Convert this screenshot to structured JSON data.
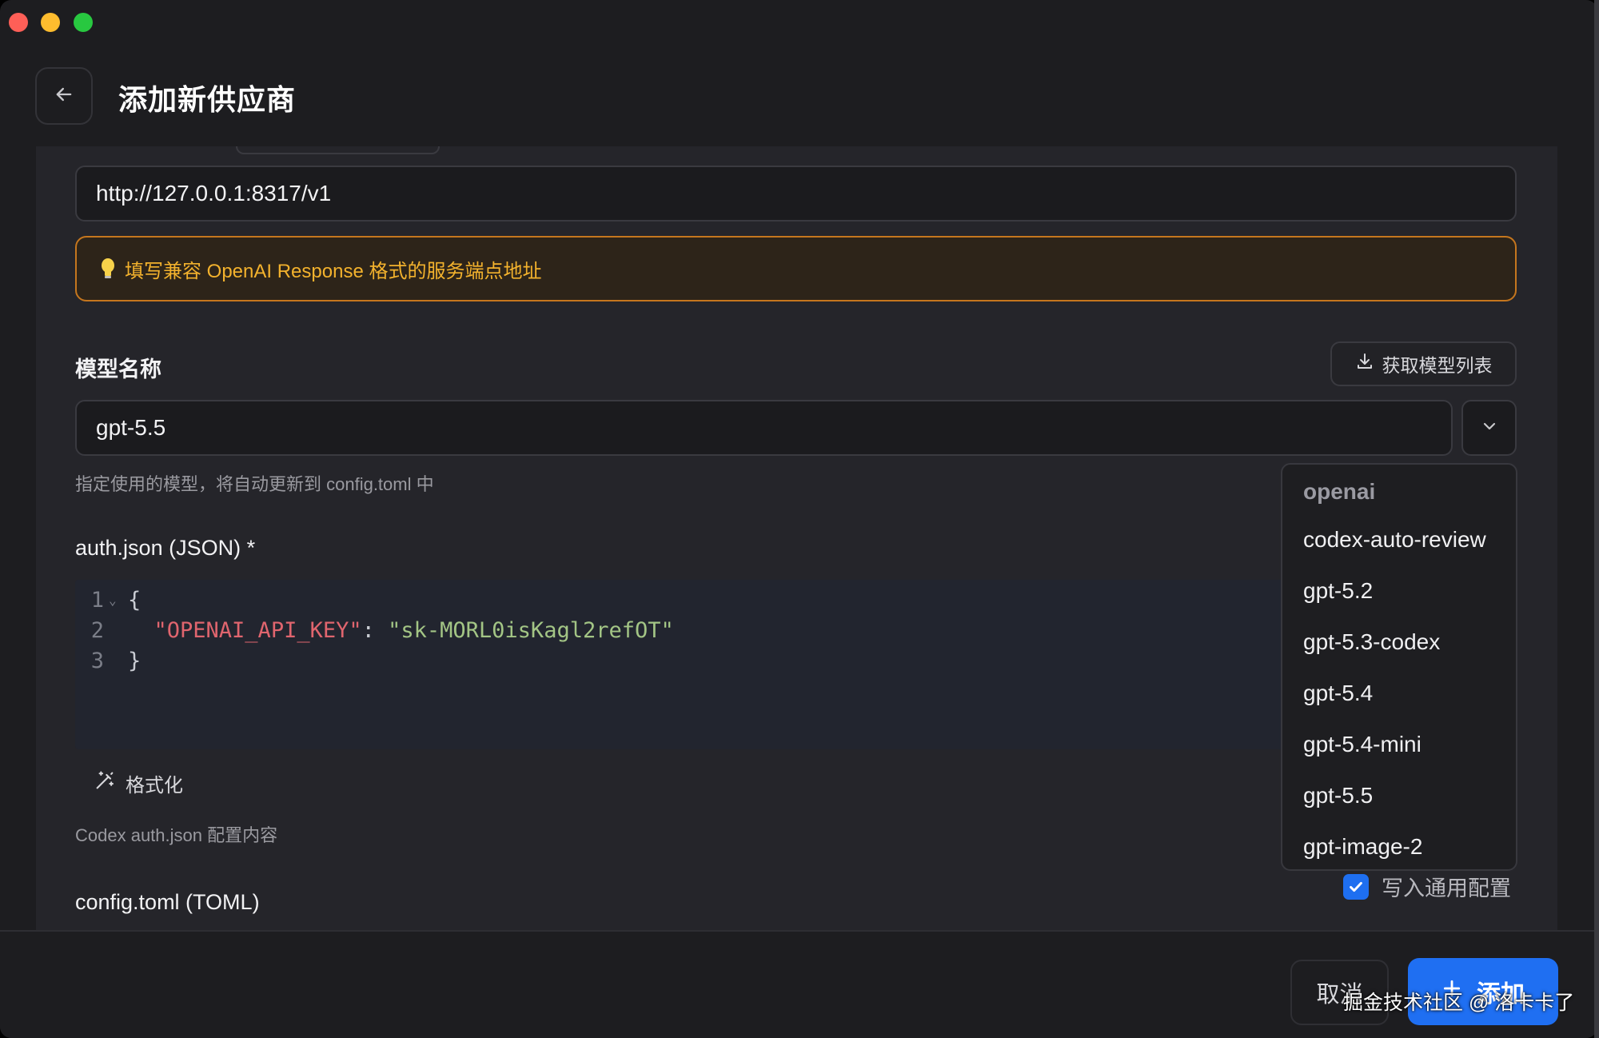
{
  "header": {
    "title": "添加新供应商"
  },
  "endpoint": {
    "url_value": "http://127.0.0.1:8317/v1",
    "tip": "填写兼容 OpenAI Response 格式的服务端点地址"
  },
  "model": {
    "label": "模型名称",
    "fetch_button": "获取模型列表",
    "value": "gpt-5.5",
    "hint": "指定使用的模型，将自动更新到 config.toml 中"
  },
  "auth": {
    "label": "auth.json (JSON) *",
    "code_lines": [
      {
        "num": "1",
        "text": "{"
      },
      {
        "num": "2",
        "key": "\"OPENAI_API_KEY\"",
        "sep": ": ",
        "value": "\"sk-MORL0isKagl2refOT\""
      },
      {
        "num": "3",
        "text": "}"
      }
    ],
    "format_button": "格式化",
    "hint": "Codex auth.json 配置内容"
  },
  "config": {
    "label": "config.toml (TOML)",
    "checkbox_label": "写入通用配置",
    "checkbox_checked": true
  },
  "model_menu": {
    "header": "openai",
    "items": [
      "codex-auto-review",
      "gpt-5.2",
      "gpt-5.3-codex",
      "gpt-5.4",
      "gpt-5.4-mini",
      "gpt-5.5",
      "gpt-image-2"
    ]
  },
  "footer": {
    "cancel": "取消",
    "add": "添加"
  },
  "watermark": "掘金技术社区 @ 洛卡卡了",
  "colors": {
    "accent": "#1f6ff2",
    "warning_border": "#c5761e",
    "warning_text": "#f3b22d",
    "json_key": "#e0656e",
    "json_string": "#a3c585"
  }
}
